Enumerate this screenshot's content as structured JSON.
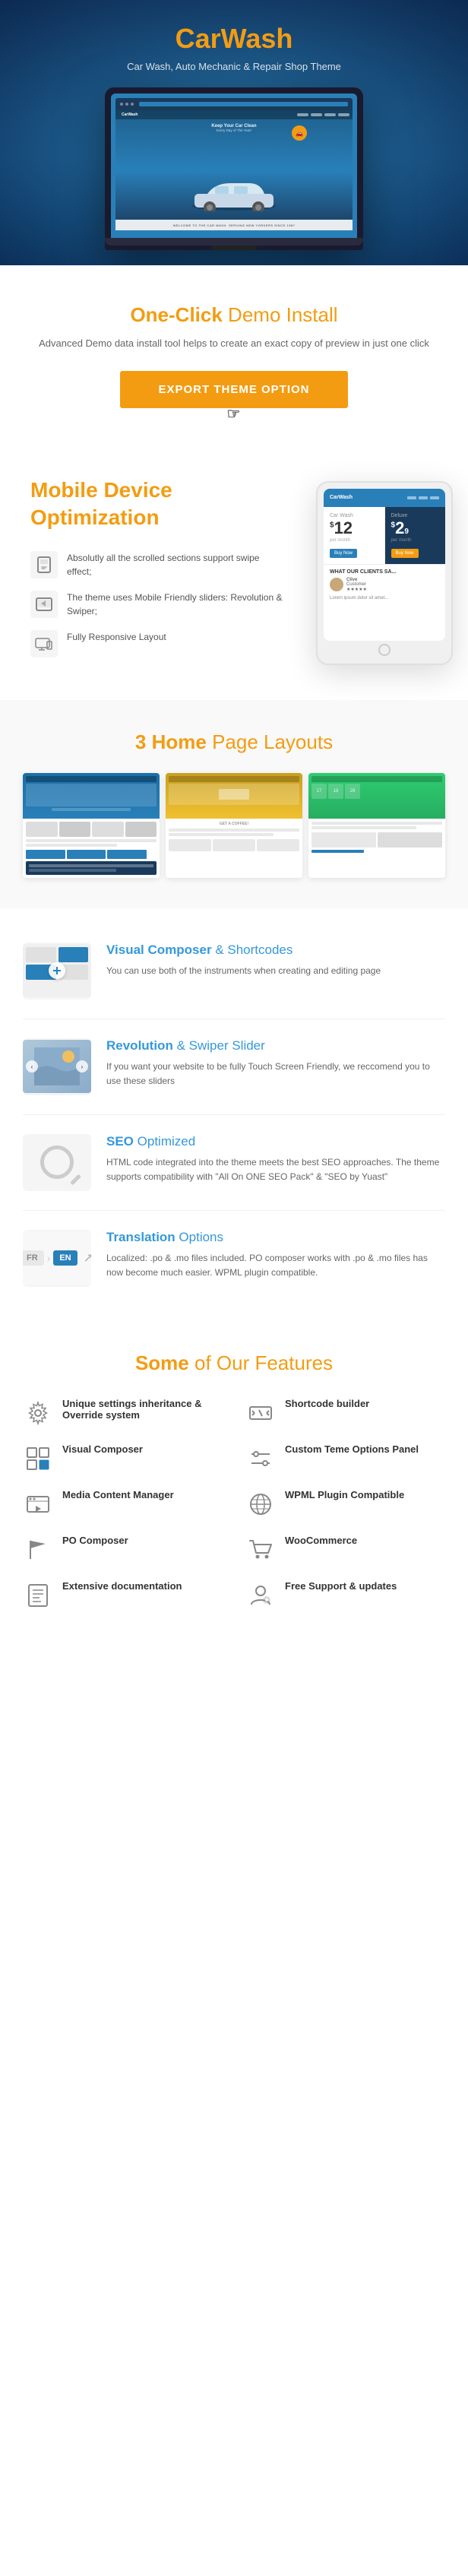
{
  "brand": {
    "name_part1": "Car",
    "name_part2": "Wash",
    "tagline": "Car Wash, Auto Mechanic & Repair Shop Theme"
  },
  "laptop": {
    "screen_title": "Keep Your Car Clean",
    "screen_subtitle": "Every Day of The Year!",
    "bottom_bar": "WELCOME TO THE CAR WASH. SERVING NEW YORKERS SINCE 1987"
  },
  "one_click": {
    "title_normal": "One-Click",
    "title_highlight": "Demo Install",
    "description": "Advanced Demo data install tool helps to create an exact copy of preview in just one click",
    "button_label": "EXPORT THEME OPTION"
  },
  "mobile": {
    "title_highlight": "Mobile",
    "title_normal": "Device Optimization",
    "features": [
      {
        "icon": "📱",
        "text": "Absolutly all the scrolled sections support swipe effect;"
      },
      {
        "icon": "📱",
        "text": "The theme uses Mobile Friendly sliders: Revolution & Swiper;"
      },
      {
        "icon": "🖥",
        "text": "Fully Responsive Layout"
      }
    ],
    "price_label": "Car Wash",
    "price": "$12",
    "price2": "$2",
    "clients_label": "WHAT OUR CLIENTS SA...",
    "client_name": "Clive"
  },
  "layouts": {
    "title_normal": "3 Home",
    "title_highlight": "Page Layouts"
  },
  "features_list": [
    {
      "title_highlight": "Visual Composer",
      "title_normal": "& Shortcodes",
      "description": "You can use both of the instruments when creating and editing page"
    },
    {
      "title_highlight": "Revolution",
      "title_normal": "& Swiper Slider",
      "description": "If you want your website to be fully Touch Screen Friendly, we reccomend you to use these sliders"
    },
    {
      "title_highlight": "SEO",
      "title_normal": "Optimized",
      "description": "HTML code integrated into the theme meets the best SEO approaches. The theme supports compatibility with \"All On ONE SEO Pack\" & \"SEO by Yuast\""
    },
    {
      "title_highlight": "Translation",
      "title_normal": "Options",
      "description": "Localized: .po & .mo files included. PO composer works with .po & .mo files has now become much easier. WPML plugin compatible."
    }
  ],
  "some_features": {
    "title_normal": "Some",
    "title_highlight": "of Our Features",
    "items": [
      {
        "icon": "⚙",
        "label": "Unique settings inheritance & Override system"
      },
      {
        "icon": "☰",
        "label": "Shortcode builder"
      },
      {
        "icon": "⊞",
        "label": "Visual Composer"
      },
      {
        "icon": "🎚",
        "label": "Custom Teme Options Panel"
      },
      {
        "icon": "🖼",
        "label": "Media Content Manager"
      },
      {
        "icon": "🌐",
        "label": "WPML Plugin Compatible"
      },
      {
        "icon": "🚩",
        "label": "PO Composer"
      },
      {
        "icon": "🛒",
        "label": "WooCommerce"
      },
      {
        "icon": "📄",
        "label": "Extensive documentation"
      },
      {
        "icon": "👤",
        "label": "Free Support & updates"
      }
    ]
  },
  "colors": {
    "accent_orange": "#f39c12",
    "accent_blue": "#3498db",
    "text_dark": "#333333",
    "text_muted": "#666666"
  }
}
